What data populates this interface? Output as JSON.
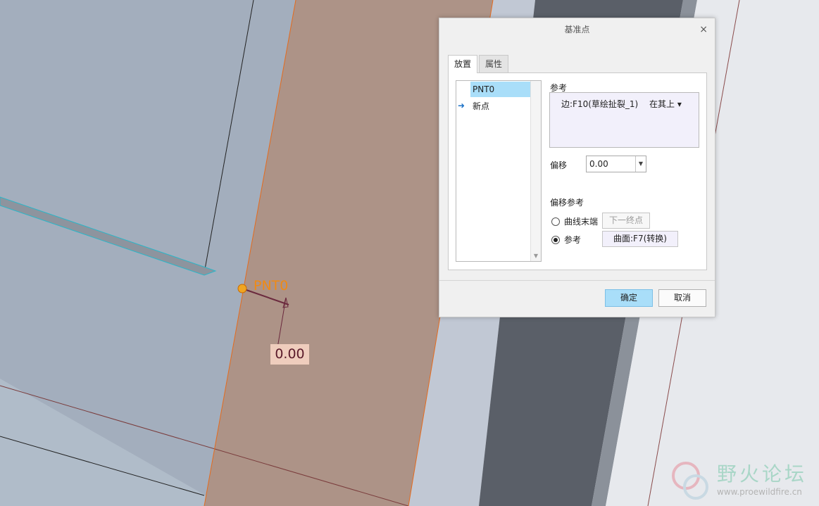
{
  "viewport": {
    "point_label": "PNT0",
    "dimension_value": "0.00"
  },
  "watermark": {
    "title": "野火论坛",
    "url": "www.proewildfire.cn"
  },
  "dialog": {
    "title": "基准点",
    "close": "×",
    "tabs": [
      {
        "label": "放置",
        "active": true
      },
      {
        "label": "属性",
        "active": false
      }
    ],
    "points": [
      {
        "label": "PNT0",
        "selected": true
      },
      {
        "label": "新点",
        "selected": false
      }
    ],
    "reference": {
      "heading": "参考",
      "item": "边:F10(草绘扯裂_1)",
      "mode": "在其上 ▾"
    },
    "offset": {
      "label": "偏移",
      "value": "0.00"
    },
    "offset_reference": {
      "heading": "偏移参考",
      "option_curve_end": "曲线末端",
      "next_endpoint_button": "下一终点",
      "option_reference": "参考",
      "reference_value": "曲面:F7(转换)",
      "selected": "参考"
    },
    "buttons": {
      "ok": "确定",
      "cancel": "取消"
    }
  }
}
